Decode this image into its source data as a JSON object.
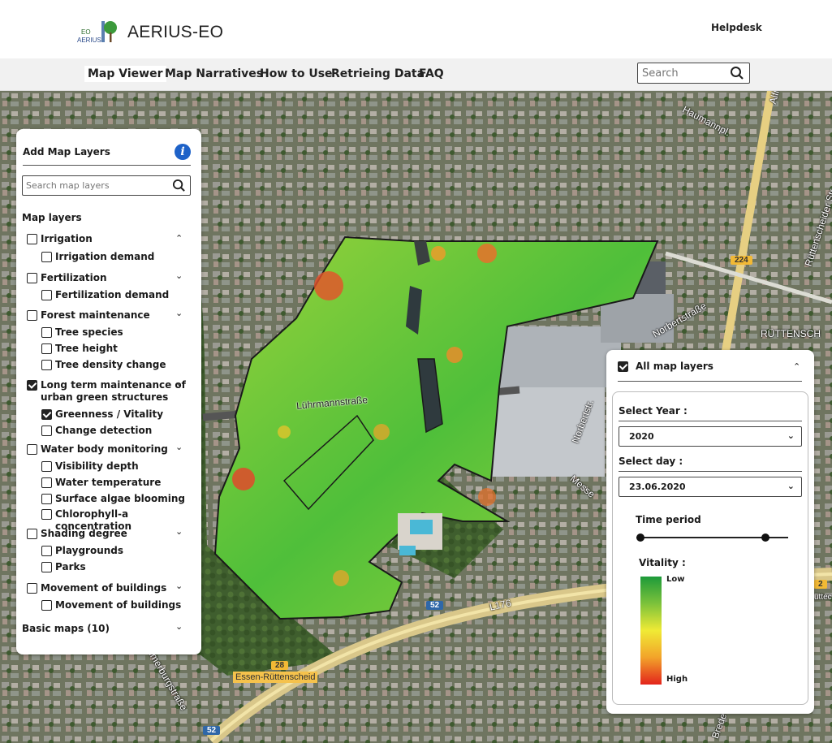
{
  "header": {
    "logo_text_top": "EO",
    "logo_text_bottom": "AERIUS",
    "title": "AERIUS-EO",
    "helpdesk": "Helpdesk"
  },
  "nav": {
    "items": [
      {
        "label": "Map Viewer",
        "active": true
      },
      {
        "label": "Map Narratives",
        "active": false
      },
      {
        "label": "How to Use",
        "active": false
      },
      {
        "label": "Retrieing Data",
        "active": false
      },
      {
        "label": "FAQ",
        "active": false
      }
    ],
    "search_placeholder": "Search"
  },
  "map": {
    "labels": {
      "haumannpl": "Haumannpl.",
      "norbertstrasse_top": "Norbertstraße",
      "ruttensch": "RÜTTENSCH",
      "ruttenscheider": "Rüttenscheider Str.",
      "lurmann": "Lührmannstraße",
      "norbertstr_side": "Norbertstr.",
      "messe": "Messe",
      "l176": "L176",
      "essen": "Essen-Rüttenscheid",
      "summerburg": "Summerburgstraße",
      "alfred": "Alfr",
      "brede": "Brede",
      "ruttec": "üttec"
    },
    "shields": {
      "r224": "224",
      "r52a": "52",
      "r52b": "52",
      "r28": "28",
      "r2": "2"
    }
  },
  "layers_panel": {
    "title": "Add Map Layers",
    "search_placeholder": "Search map layers",
    "section": "Map layers",
    "groups": [
      {
        "label": "Irrigation",
        "checked": false,
        "expanded": true,
        "children": [
          {
            "label": "Irrigation demand",
            "checked": false
          }
        ]
      },
      {
        "label": "Fertilization",
        "checked": false,
        "expanded": false,
        "children": [
          {
            "label": "Fertilization demand",
            "checked": false
          }
        ]
      },
      {
        "label": "Forest maintenance",
        "checked": false,
        "expanded": false,
        "children": [
          {
            "label": "Tree species",
            "checked": false
          },
          {
            "label": "Tree height",
            "checked": false
          },
          {
            "label": "Tree density change",
            "checked": false
          }
        ]
      },
      {
        "label_line1": "Long term maintenance of",
        "label_line2": "urban green structures",
        "checked": true,
        "expanded": false,
        "children": [
          {
            "label": "Greenness / Vitality",
            "checked": true
          },
          {
            "label": "Change detection",
            "checked": false
          }
        ]
      },
      {
        "label": "Water body monitoring",
        "checked": false,
        "expanded": false,
        "children": [
          {
            "label": "Visibility depth",
            "checked": false
          },
          {
            "label": "Water temperature",
            "checked": false
          },
          {
            "label": "Surface algae blooming",
            "checked": false
          },
          {
            "label": "Chlorophyll-a concentration",
            "checked": false
          }
        ]
      },
      {
        "label": "Shading degree",
        "checked": false,
        "expanded": false,
        "children": [
          {
            "label": "Playgrounds",
            "checked": false
          },
          {
            "label": "Parks",
            "checked": false
          }
        ]
      },
      {
        "label": "Movement of buildings",
        "checked": false,
        "expanded": false,
        "children": [
          {
            "label": "Movement of buildings",
            "checked": false
          }
        ]
      }
    ],
    "basic_maps": "Basic maps (10)"
  },
  "filter_panel": {
    "all_layers_label": "All map layers",
    "all_layers_checked": true,
    "year_label": "Select Year :",
    "year_value": "2020",
    "day_label": "Select day :",
    "day_value": "23.06.2020",
    "time_period_label": "Time period",
    "time_period_start": 0,
    "time_period_end": 0.87,
    "vitality_label": "Vitality :",
    "legend_low": "Low",
    "legend_high": "High",
    "legend_colors": [
      "#1d9a3a",
      "#7cc23b",
      "#f0ea35",
      "#f2a32a",
      "#e3241c"
    ]
  }
}
